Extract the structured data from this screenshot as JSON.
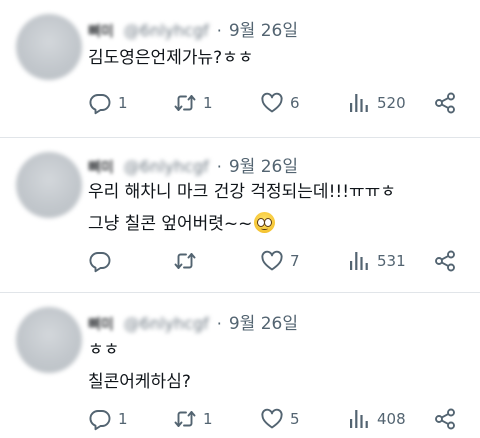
{
  "tweets": [
    {
      "author_name": "뼈미",
      "handle": "@6nlyhcgf",
      "separator": "·",
      "date": "9월 26일",
      "lines": [
        "김도영은언제가뉴?ㅎㅎ"
      ],
      "emoji": null,
      "counts": {
        "reply": "1",
        "retweet": "1",
        "like": "6",
        "views": "520"
      }
    },
    {
      "author_name": "뼈미",
      "handle": "@6nlyhcgf",
      "separator": "·",
      "date": "9월 26일",
      "lines": [
        "우리 해차니 마크 건강 걱정되는데!!!ㅠㅠㅎ",
        "그냥 칠콘 엎어버렷~~"
      ],
      "emoji": "pleading-face-emoji",
      "counts": {
        "reply": "",
        "retweet": "",
        "like": "7",
        "views": "531"
      }
    },
    {
      "author_name": "뼈미",
      "handle": "@6nlyhcgf",
      "separator": "·",
      "date": "9월 26일",
      "lines": [
        "ㅎㅎ",
        "칠콘어케하심?"
      ],
      "emoji": null,
      "counts": {
        "reply": "1",
        "retweet": "1",
        "like": "5",
        "views": "408"
      }
    }
  ],
  "icons": {
    "reply": "reply-icon",
    "retweet": "retweet-icon",
    "like": "heart-icon",
    "views": "views-icon",
    "share": "share-icon"
  },
  "colors": {
    "text": "#0f1419",
    "secondary": "#536471",
    "divider": "#e1e5e9",
    "background": "#ffffff"
  }
}
